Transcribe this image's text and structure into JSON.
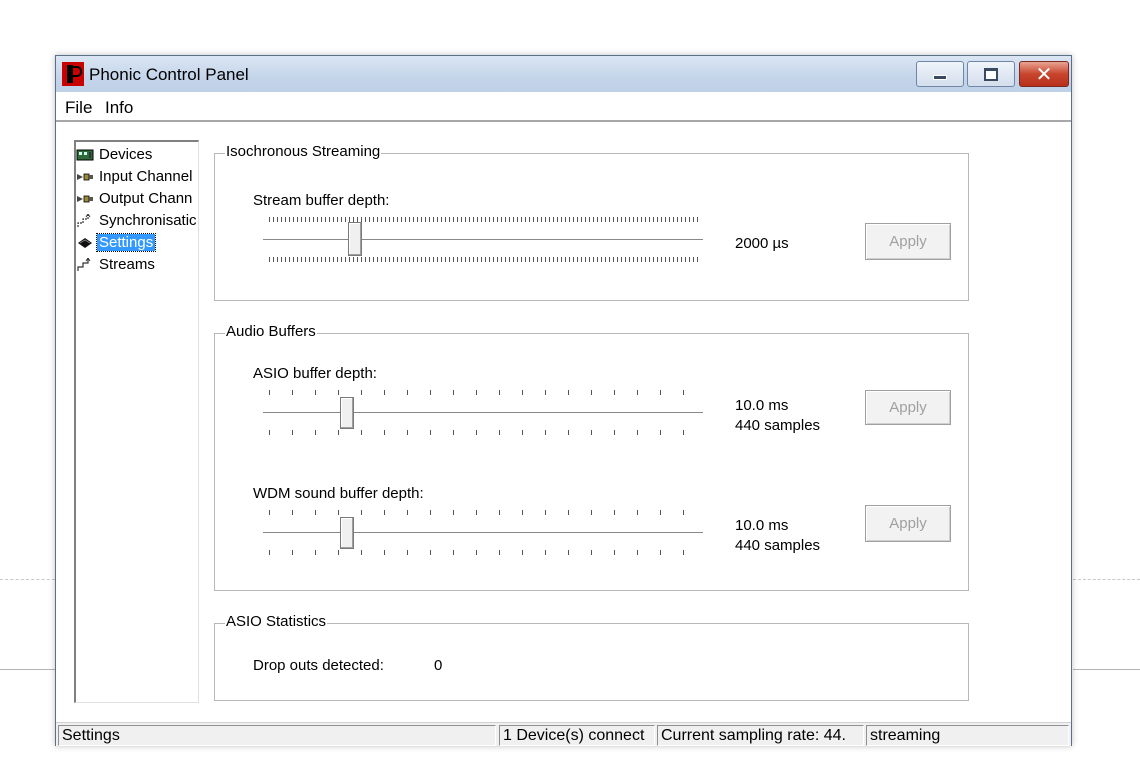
{
  "window": {
    "title": "Phonic Control Panel",
    "caption_buttons": {
      "minimize": "minimize",
      "maximize": "maximize",
      "close": "close"
    }
  },
  "menu": {
    "file": "File",
    "info": "Info"
  },
  "tree": {
    "items": [
      {
        "label": "Devices",
        "icon": "devices-icon"
      },
      {
        "label": "Input Channel",
        "icon": "input-channels-icon"
      },
      {
        "label": "Output Chann",
        "icon": "output-channels-icon"
      },
      {
        "label": "Synchronisatic",
        "icon": "synchronisation-icon"
      },
      {
        "label": "Settings",
        "icon": "settings-icon",
        "selected": true
      },
      {
        "label": "Streams",
        "icon": "streams-icon"
      }
    ]
  },
  "iso": {
    "title": "Isochronous Streaming",
    "label": "Stream buffer depth:",
    "value": "2000 µs",
    "apply": "Apply",
    "slider_level": 0.2
  },
  "audio": {
    "title": "Audio Buffers",
    "asio_label": "ASIO buffer depth:",
    "asio_value_ms": "10.0 ms",
    "asio_value_samples": "440 samples",
    "asio_apply": "Apply",
    "asio_level": 0.18,
    "wdm_label": "WDM sound buffer depth:",
    "wdm_value_ms": "10.0 ms",
    "wdm_value_samples": "440 samples",
    "wdm_apply": "Apply",
    "wdm_level": 0.18
  },
  "stats": {
    "title": "ASIO Statistics",
    "dropouts_label": "Drop outs detected:",
    "dropouts_value": "0"
  },
  "status": {
    "section": "Settings",
    "devices": "1 Device(s) connect",
    "rate": "Current sampling rate: 44.",
    "state": "streaming"
  }
}
